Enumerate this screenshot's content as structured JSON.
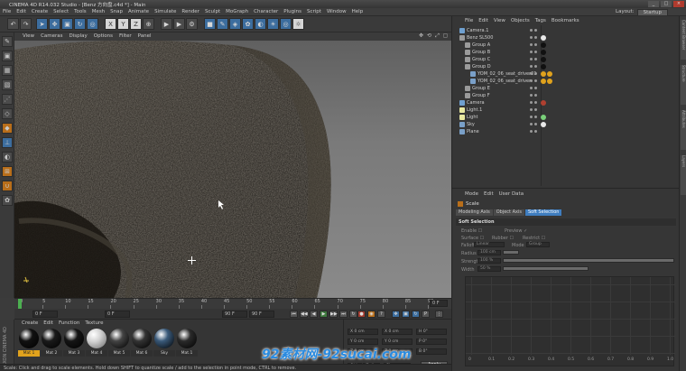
{
  "window": {
    "title": "CINEMA 4D R14.032 Studio - [Benz 方向盘.c4d *] - Main",
    "controls": [
      "_",
      "□",
      "×"
    ]
  },
  "menubar": {
    "items": [
      "File",
      "Edit",
      "Create",
      "Select",
      "Tools",
      "Mesh",
      "Snap",
      "Animate",
      "Simulate",
      "Render",
      "Sculpt",
      "MoGraph",
      "Character",
      "Plugins",
      "Script",
      "Window",
      "Help"
    ],
    "layout_label": "Layout:",
    "layout_value": "Startup"
  },
  "toolbar": {
    "buttons": [
      {
        "name": "undo-icon",
        "glyph": "↶"
      },
      {
        "name": "redo-icon",
        "glyph": "↷"
      },
      {
        "name": "live-select-icon",
        "glyph": "➤"
      },
      {
        "name": "move-icon",
        "glyph": "✥"
      },
      {
        "name": "scale-icon",
        "glyph": "▣"
      },
      {
        "name": "rotate-icon",
        "glyph": "↻"
      },
      {
        "name": "last-tool-icon",
        "glyph": "◎"
      },
      {
        "name": "x-axis-lock",
        "glyph": "X"
      },
      {
        "name": "y-axis-lock",
        "glyph": "Y"
      },
      {
        "name": "z-axis-lock",
        "glyph": "Z"
      },
      {
        "name": "coord-system-icon",
        "glyph": "⊕"
      },
      {
        "name": "render-view-icon",
        "glyph": "▶"
      },
      {
        "name": "render-picture-viewer-icon",
        "glyph": "▶"
      },
      {
        "name": "render-settings-icon",
        "glyph": "⚙"
      },
      {
        "name": "cube-icon",
        "glyph": "■"
      },
      {
        "name": "nurbs-icon",
        "glyph": "✎"
      },
      {
        "name": "subdivision-icon",
        "glyph": "◈"
      },
      {
        "name": "array-icon",
        "glyph": "✿"
      },
      {
        "name": "deformer-icon",
        "glyph": "◐"
      },
      {
        "name": "scene-icon",
        "glyph": "☀"
      },
      {
        "name": "camera-icon",
        "glyph": "◎"
      },
      {
        "name": "light-icon",
        "glyph": "☼"
      }
    ]
  },
  "viewport": {
    "menu": [
      "View",
      "Cameras",
      "Display",
      "Options",
      "Filter",
      "Panel"
    ],
    "nav_icons": [
      "✥",
      "⟲",
      "⤢",
      "▢"
    ]
  },
  "timeline": {
    "ticks": [
      "0",
      "5",
      "10",
      "15",
      "20",
      "25",
      "30",
      "35",
      "40",
      "45",
      "50",
      "55",
      "60",
      "65",
      "70",
      "75",
      "80",
      "85",
      "90"
    ],
    "current_frame": "0 F"
  },
  "playback": {
    "start": "0 F",
    "current": "0 F",
    "end": "90 F",
    "end2": "90 F",
    "buttons": [
      "⏮",
      "◀◀",
      "◀",
      "▶",
      "▶▶",
      "⏭",
      "↻"
    ]
  },
  "materials": {
    "side_label": "MAXON CINEMA 4D",
    "menu": [
      "Create",
      "Edit",
      "Function",
      "Texture"
    ],
    "items": [
      {
        "label": "Mat 1",
        "color": "#111111",
        "active": true
      },
      {
        "label": "Mat 2",
        "color": "#1a1a1a",
        "active": false
      },
      {
        "label": "Mat 3",
        "color": "#151515",
        "active": false
      },
      {
        "label": "Mat 4",
        "color": "#d8d8d8",
        "active": false
      },
      {
        "label": "Mat 5",
        "color": "#444444",
        "active": false
      },
      {
        "label": "Mat 6",
        "color": "#333333",
        "active": false
      },
      {
        "label": "Sky",
        "color": "#3a5a7a",
        "active": false
      },
      {
        "label": "Mat.1",
        "color": "#2a2a2a",
        "active": false
      }
    ]
  },
  "coords": {
    "rows": [
      {
        "a": "X 0 cm",
        "b": "X 0 cm",
        "c": "H 0°"
      },
      {
        "a": "Y 0 cm",
        "b": "Y 0 cm",
        "c": "P 0°"
      },
      {
        "a": "Z 0 cm",
        "b": "Z 0 cm",
        "c": "B 0°"
      }
    ],
    "mode_a": "Object (Rel)",
    "mode_b": "Size",
    "apply": "Apply"
  },
  "status": {
    "text": "Scale: Click and drag to scale elements. Hold down SHIFT to quantize scale / add to the selection in point mode, CTRL to remove."
  },
  "watermark": {
    "text": "92素材网-92sucai.com"
  },
  "object_manager": {
    "menu": [
      "File",
      "Edit",
      "View",
      "Objects",
      "Tags",
      "Bookmarks"
    ],
    "rows": [
      {
        "name": "Camera.1",
        "indent": 0,
        "icon": "#6fa0d0",
        "tags": []
      },
      {
        "name": "Benz SL500",
        "indent": 0,
        "icon": "#9a9a9a",
        "tags": [
          "#e8e8e8"
        ]
      },
      {
        "name": "Group A",
        "indent": 1,
        "icon": "#9a9a9a",
        "tags": [
          "#111111"
        ]
      },
      {
        "name": "Group B",
        "indent": 1,
        "icon": "#9a9a9a",
        "tags": [
          "#111111"
        ]
      },
      {
        "name": "Group C",
        "indent": 1,
        "icon": "#9a9a9a",
        "tags": [
          "#111111"
        ]
      },
      {
        "name": "Group D",
        "indent": 1,
        "icon": "#9a9a9a",
        "tags": [
          "#111111"
        ]
      },
      {
        "name": "YOM_02_06_seat_driver01",
        "indent": 2,
        "icon": "#7aa0c8",
        "tags": [
          "#e0a21d",
          "#e0a21d"
        ]
      },
      {
        "name": "YOM_02_06_seat_driver",
        "indent": 2,
        "icon": "#7aa0c8",
        "tags": [
          "#e0a21d",
          "#e0a21d"
        ]
      },
      {
        "name": "Group E",
        "indent": 1,
        "icon": "#9a9a9a",
        "tags": []
      },
      {
        "name": "Group F",
        "indent": 1,
        "icon": "#9a9a9a",
        "tags": []
      },
      {
        "name": "Camera",
        "indent": 0,
        "icon": "#6fa0d0",
        "tags": [
          "#b04030"
        ]
      },
      {
        "name": "Light.1",
        "indent": 0,
        "icon": "#e8e8a0",
        "tags": []
      },
      {
        "name": "Light",
        "indent": 0,
        "icon": "#e8e8a0",
        "tags": [
          "#7ad07a"
        ]
      },
      {
        "name": "Sky",
        "indent": 0,
        "icon": "#7aa0c8",
        "tags": [
          "#e8e8e8"
        ]
      },
      {
        "name": "Plane",
        "indent": 0,
        "icon": "#7aa0c8",
        "tags": []
      }
    ]
  },
  "attributes": {
    "menu": [
      "Mode",
      "Edit",
      "User Data"
    ],
    "title": "Scale",
    "tabs": [
      "Modeling Axis",
      "Object Axis",
      "Soft Selection"
    ],
    "active_tab": "Soft Selection",
    "section": "Soft Selection",
    "props": [
      {
        "l": "Enable",
        "v": "☐"
      },
      {
        "l": "Preview",
        "v": "✓"
      },
      {
        "l": "Surface",
        "v": "☐"
      },
      {
        "l": "Rubber",
        "v": "☐"
      },
      {
        "l": "Restrict",
        "v": "☐"
      }
    ],
    "falloff_label": "Falloff",
    "falloff_value": "Linear",
    "mode_label": "Mode",
    "mode_value": "Group",
    "radius_label": "Radius",
    "radius_value": "100 cm",
    "strength_label": "Strength",
    "strength_value": "100 %",
    "width_label": "Width",
    "width_value": "50 %",
    "graph_x_labels": [
      "0",
      "0.1",
      "0.2",
      "0.3",
      "0.4",
      "0.5",
      "0.6",
      "0.7",
      "0.8",
      "0.9",
      "1.0"
    ]
  },
  "right_tabs": [
    "Content Browser",
    "Structure",
    "Attributes",
    "Layers"
  ]
}
